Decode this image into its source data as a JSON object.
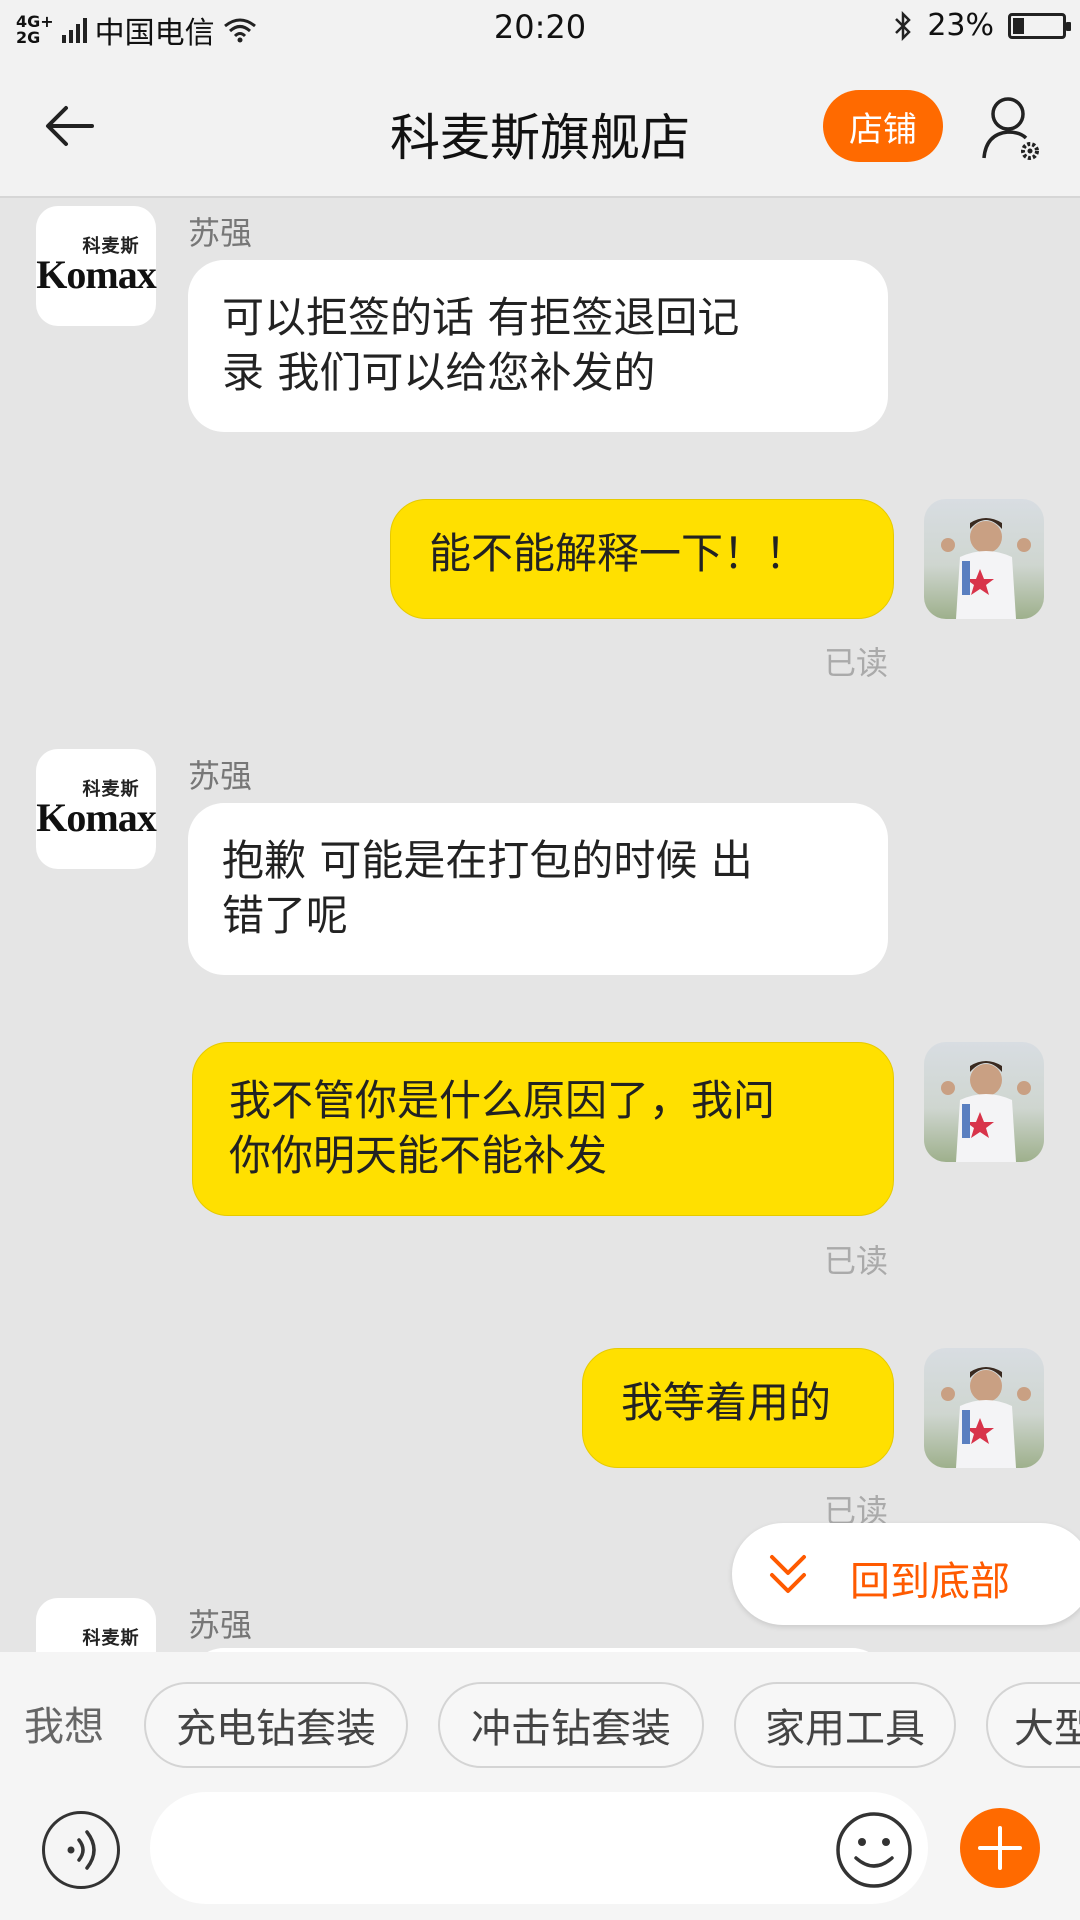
{
  "status_bar": {
    "network_top": "4G+",
    "network_bottom": "2G",
    "carrier": "中国电信",
    "time": "20:20",
    "battery_text": "23%",
    "battery_level": 0.23,
    "icons": [
      "signal-icon",
      "wifi-icon",
      "bluetooth-icon",
      "battery-icon"
    ]
  },
  "header": {
    "title": "科麦斯旗舰店",
    "shop_button": "店铺",
    "icons": [
      "back-arrow-icon",
      "user-settings-icon"
    ]
  },
  "shop_avatar": {
    "logo_cn": "科麦斯",
    "logo_en": "Komax"
  },
  "messages": [
    {
      "from": "shop",
      "sender": "苏强",
      "lines": [
        "可以拒签的话 有拒签退回记",
        "录 我们可以给您补发的"
      ]
    },
    {
      "from": "me",
      "lines": [
        "能不能解释一下！！"
      ],
      "status": "已读"
    },
    {
      "from": "shop",
      "sender": "苏强",
      "lines": [
        "抱歉 可能是在打包的时候 出",
        "错了呢"
      ]
    },
    {
      "from": "me",
      "lines": [
        "我不管你是什么原因了，我问",
        "你你明天能不能补发"
      ],
      "status": "已读"
    },
    {
      "from": "me",
      "lines": [
        "我等着用的"
      ],
      "status": "已读"
    },
    {
      "from": "shop",
      "sender": "苏强",
      "lines": []
    }
  ],
  "scroll_to_bottom": {
    "label": "回到底部",
    "icon": "double-chevron-down-icon"
  },
  "quick_phrases": {
    "prefix": "我想",
    "chips": [
      "充电钻套装",
      "冲击钻套装",
      "家用工具",
      "大型"
    ]
  },
  "input_bar": {
    "placeholder": "",
    "icons": [
      "voice-icon",
      "emoji-icon",
      "plus-icon"
    ]
  },
  "colors": {
    "accent": "#ff6a00",
    "my_bubble": "#ffe000",
    "chat_background": "#e5e5e5",
    "link_orange": "#ff5a00"
  }
}
